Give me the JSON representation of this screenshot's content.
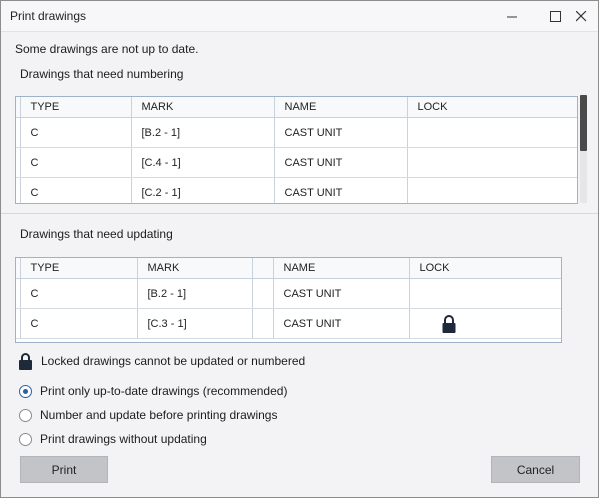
{
  "window": {
    "title": "Print drawings"
  },
  "message": "Some drawings are not up to date.",
  "numbering": {
    "label": "Drawings that need numbering",
    "columns": [
      "TYPE",
      "MARK",
      "NAME",
      "LOCK"
    ],
    "rows": [
      {
        "type": "C",
        "mark": "[B.2 - 1]",
        "name": "CAST UNIT",
        "lock": ""
      },
      {
        "type": "C",
        "mark": "[C.4 - 1]",
        "name": "CAST UNIT",
        "lock": ""
      },
      {
        "type": "C",
        "mark": "[C.2 - 1]",
        "name": "CAST UNIT",
        "lock": ""
      }
    ]
  },
  "updating": {
    "label": "Drawings that need updating",
    "columns": [
      "TYPE",
      "MARK",
      "",
      "NAME",
      "LOCK"
    ],
    "rows": [
      {
        "type": "C",
        "mark": "[B.2 - 1]",
        "name": "CAST UNIT",
        "locked": false
      },
      {
        "type": "C",
        "mark": "[C.3 - 1]",
        "name": "CAST UNIT",
        "locked": true
      }
    ]
  },
  "lock_note": "Locked drawings cannot be updated or numbered",
  "options": [
    {
      "label": "Print only up-to-date drawings (recommended)",
      "checked": true
    },
    {
      "label": "Number and update before printing drawings",
      "checked": false
    },
    {
      "label": "Print drawings without updating",
      "checked": false
    }
  ],
  "buttons": {
    "print": "Print",
    "cancel": "Cancel"
  },
  "icons": [
    "minimize-icon",
    "maximize-icon",
    "close-icon",
    "lock-icon"
  ],
  "colors": {
    "accent": "#2b5fa8",
    "grid_border": "#9fb2c8",
    "button": "#c3c4c8"
  }
}
